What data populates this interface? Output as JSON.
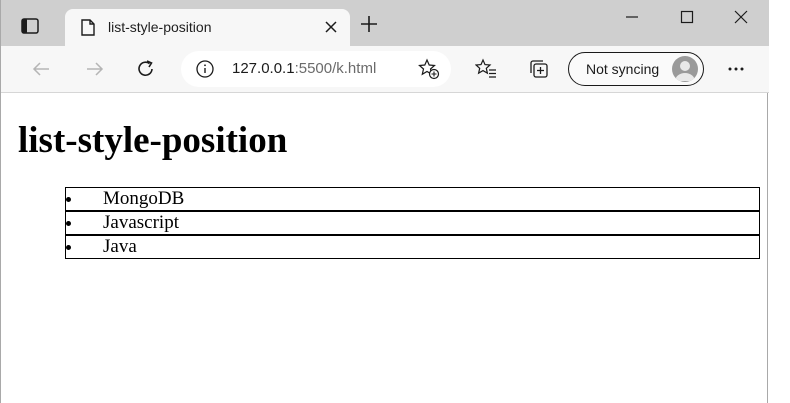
{
  "browser": {
    "tab_title": "list-style-position",
    "url_host": "127.0.0.1",
    "url_rest": ":5500/k.html",
    "sync_label": "Not syncing"
  },
  "page": {
    "heading": "list-style-position",
    "items": [
      "MongoDB",
      "Javascript",
      "Java"
    ]
  },
  "icons": {
    "tab_actions": "tab-actions-icon",
    "page": "page-icon",
    "close": "close-icon",
    "new_tab": "plus-icon",
    "back": "back-arrow-icon",
    "forward": "forward-arrow-icon",
    "refresh": "refresh-icon",
    "info": "info-icon",
    "add_favorite": "star-plus-icon",
    "favorites": "favorites-icon",
    "collections": "collections-icon",
    "more": "more-icon"
  }
}
